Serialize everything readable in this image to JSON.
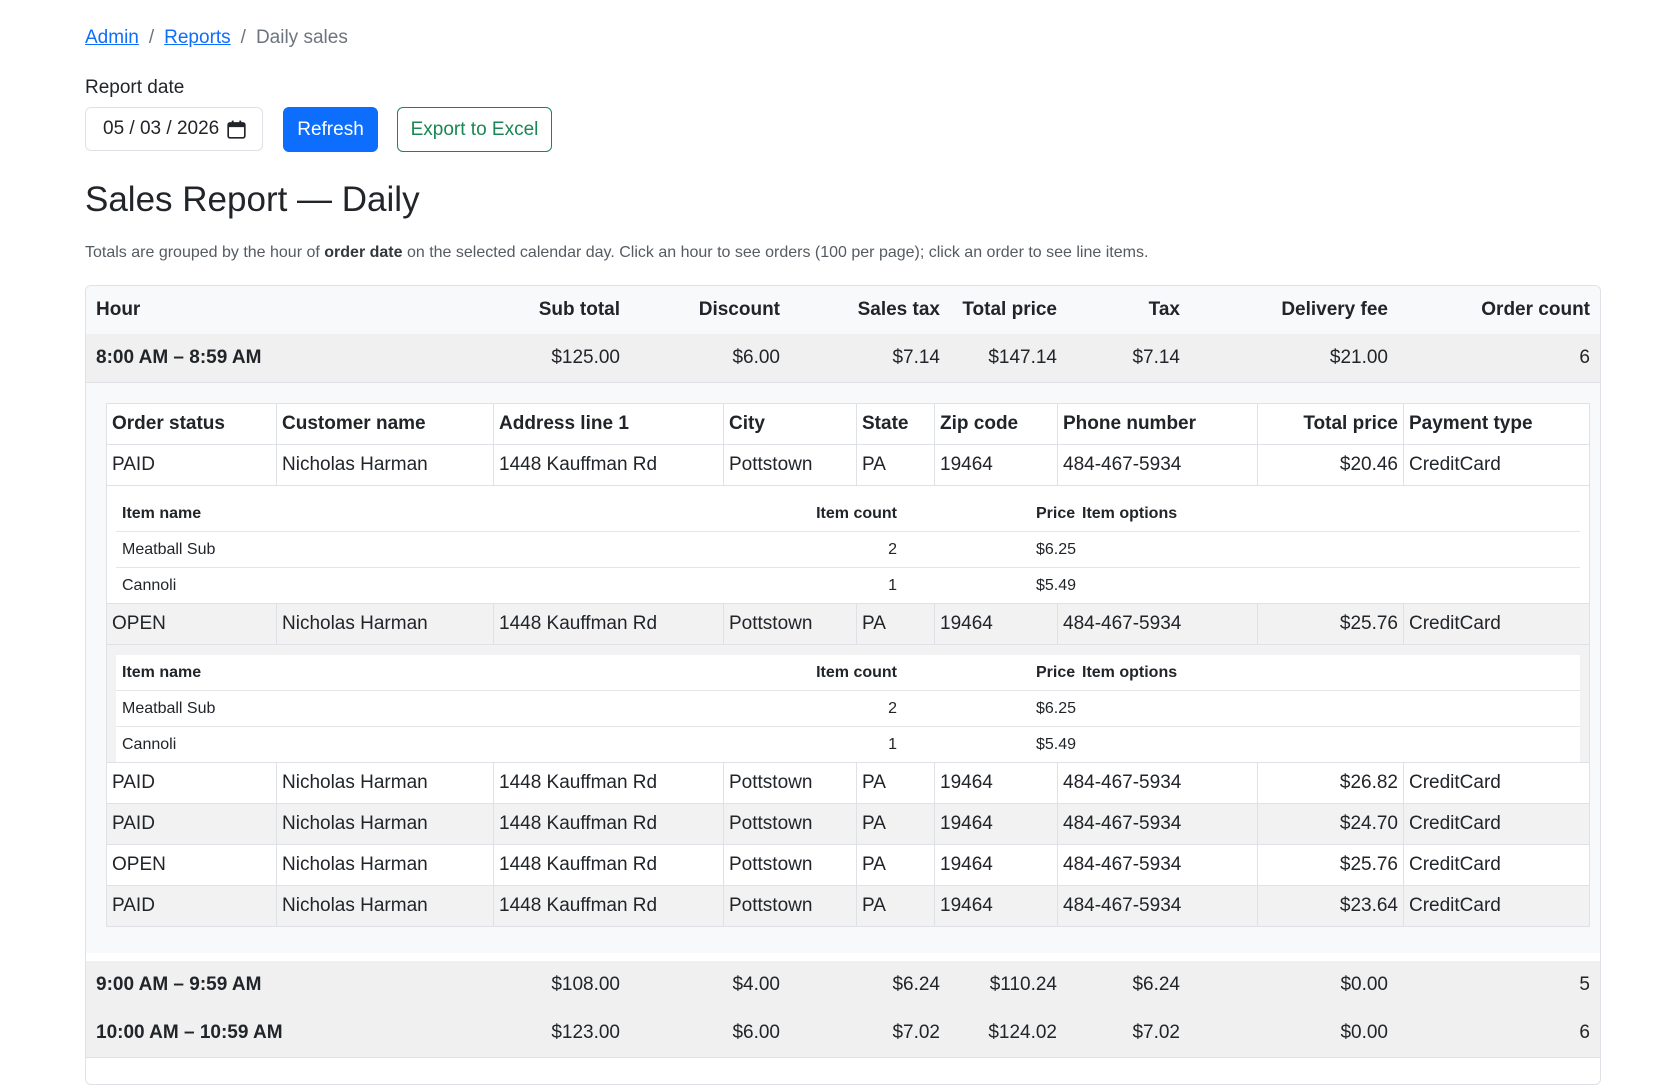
{
  "breadcrumb": {
    "admin": "Admin",
    "reports": "Reports",
    "current": "Daily sales",
    "separator": "/"
  },
  "controls": {
    "report_date_label": "Report date",
    "date_value": "05 / 03 / 2026",
    "refresh_label": "Refresh",
    "export_label": "Export to Excel"
  },
  "page": {
    "title": "Sales Report — Daily",
    "desc_part1": "Totals are grouped by the hour of ",
    "desc_bold": "order date",
    "desc_part2": " on the selected calendar day. Click an hour to see orders (100 per page); click an order to see line items."
  },
  "hour_table": {
    "headers": [
      "Hour",
      "Sub total",
      "Discount",
      "Sales tax",
      "Total price",
      "Tax",
      "Delivery fee",
      "Order count"
    ],
    "rows": [
      {
        "hour": "8:00 AM – 8:59 AM",
        "sub_total": "$125.00",
        "discount": "$6.00",
        "sales_tax": "$7.14",
        "total_price": "$147.14",
        "tax": "$7.14",
        "delivery_fee": "$21.00",
        "order_count": "6"
      },
      {
        "hour": "9:00 AM – 9:59 AM",
        "sub_total": "$108.00",
        "discount": "$4.00",
        "sales_tax": "$6.24",
        "total_price": "$110.24",
        "tax": "$6.24",
        "delivery_fee": "$0.00",
        "order_count": "5"
      },
      {
        "hour": "10:00 AM – 10:59 AM",
        "sub_total": "$123.00",
        "discount": "$6.00",
        "sales_tax": "$7.02",
        "total_price": "$124.02",
        "tax": "$7.02",
        "delivery_fee": "$0.00",
        "order_count": "6"
      }
    ]
  },
  "orders_table": {
    "headers": [
      "Order status",
      "Customer name",
      "Address line 1",
      "City",
      "State",
      "Zip code",
      "Phone number",
      "Total price",
      "Payment type"
    ],
    "rows": [
      {
        "status": "PAID",
        "customer": "Nicholas Harman",
        "address": "1448 Kauffman Rd",
        "city": "Pottstown",
        "state": "PA",
        "zip": "19464",
        "phone": "484-467-5934",
        "total": "$20.46",
        "payment": "CreditCard"
      },
      {
        "status": "OPEN",
        "customer": "Nicholas Harman",
        "address": "1448 Kauffman Rd",
        "city": "Pottstown",
        "state": "PA",
        "zip": "19464",
        "phone": "484-467-5934",
        "total": "$25.76",
        "payment": "CreditCard"
      },
      {
        "status": "PAID",
        "customer": "Nicholas Harman",
        "address": "1448 Kauffman Rd",
        "city": "Pottstown",
        "state": "PA",
        "zip": "19464",
        "phone": "484-467-5934",
        "total": "$26.82",
        "payment": "CreditCard"
      },
      {
        "status": "PAID",
        "customer": "Nicholas Harman",
        "address": "1448 Kauffman Rd",
        "city": "Pottstown",
        "state": "PA",
        "zip": "19464",
        "phone": "484-467-5934",
        "total": "$24.70",
        "payment": "CreditCard"
      },
      {
        "status": "OPEN",
        "customer": "Nicholas Harman",
        "address": "1448 Kauffman Rd",
        "city": "Pottstown",
        "state": "PA",
        "zip": "19464",
        "phone": "484-467-5934",
        "total": "$25.76",
        "payment": "CreditCard"
      },
      {
        "status": "PAID",
        "customer": "Nicholas Harman",
        "address": "1448 Kauffman Rd",
        "city": "Pottstown",
        "state": "PA",
        "zip": "19464",
        "phone": "484-467-5934",
        "total": "$23.64",
        "payment": "CreditCard"
      }
    ]
  },
  "line_items": {
    "headers": [
      "Item name",
      "Item count",
      "Price",
      "Item options"
    ],
    "order1": [
      {
        "name": "Meatball Sub",
        "count": "2",
        "price": "$6.25",
        "options": ""
      },
      {
        "name": "Cannoli",
        "count": "1",
        "price": "$5.49",
        "options": ""
      }
    ],
    "order2": [
      {
        "name": "Meatball Sub",
        "count": "2",
        "price": "$6.25",
        "options": ""
      },
      {
        "name": "Cannoli",
        "count": "1",
        "price": "$5.49",
        "options": ""
      }
    ]
  },
  "colors": {
    "primary": "#0d6efd",
    "success": "#198754",
    "border": "#dee2e6",
    "band": "#f0f0f0"
  },
  "icons": {
    "date_picker": "calendar-icon"
  }
}
